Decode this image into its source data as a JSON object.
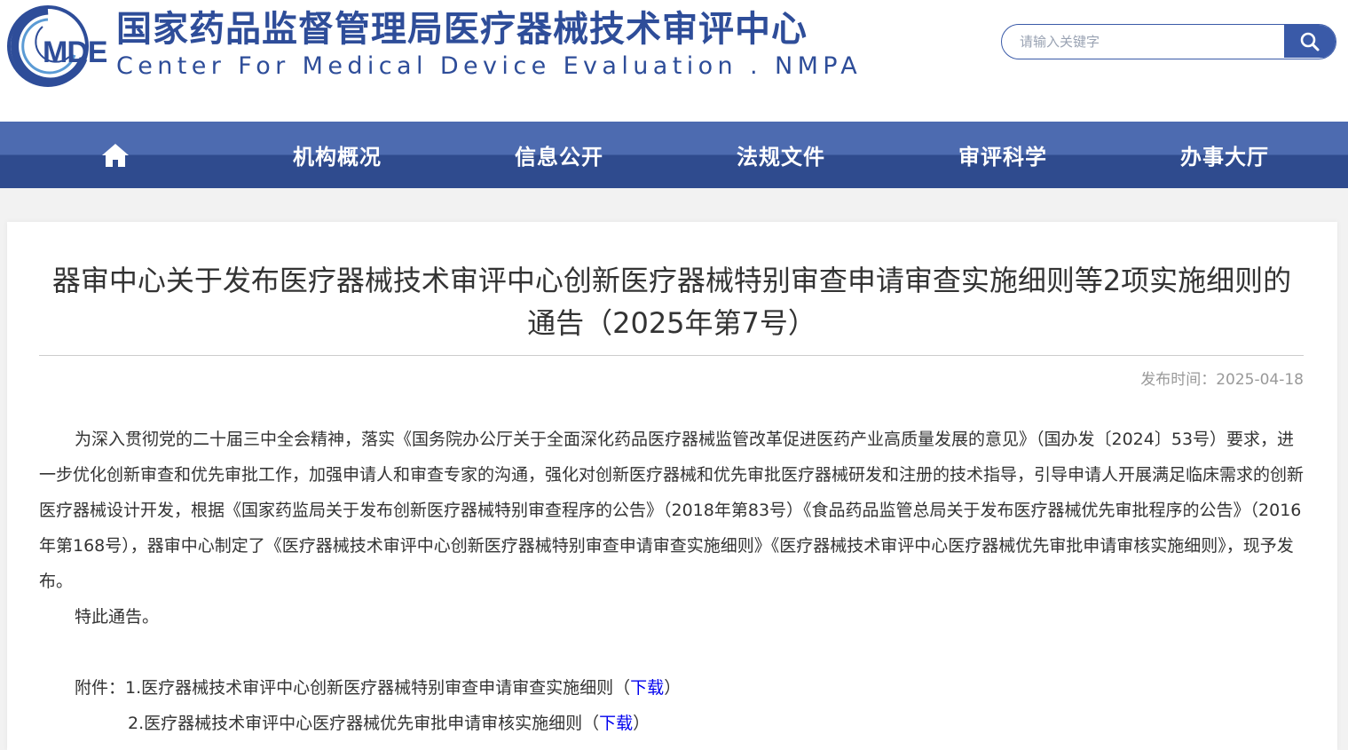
{
  "header": {
    "logo_text": "MDE",
    "title_cn": "国家药品监督管理局医疗器械技术审评中心",
    "title_en": "Center For Medical Device Evaluation . NMPA",
    "search_placeholder": "请输入关键字"
  },
  "nav": {
    "home_icon": "home-icon",
    "items": [
      "机构概况",
      "信息公开",
      "法规文件",
      "审评科学",
      "办事大厅"
    ]
  },
  "article": {
    "title": "器审中心关于发布医疗器械技术审评中心创新医疗器械特别审查申请审查实施细则等2项实施细则的通告（2025年第7号）",
    "pubtime_label": "发布时间：",
    "pubtime_value": "2025-04-18",
    "paragraph1": "为深入贯彻党的二十届三中全会精神，落实《国务院办公厅关于全面深化药品医疗器械监管改革促进医药产业高质量发展的意见》（国办发〔2024〕53号）要求，进一步优化创新审查和优先审批工作，加强申请人和审查专家的沟通，强化对创新医疗器械和优先审批医疗器械研发和注册的技术指导，引导申请人开展满足临床需求的创新医疗器械设计开发，根据《国家药监局关于发布创新医疗器械特别审查程序的公告》（2018年第83号）《食品药品监管总局关于发布医疗器械优先审批程序的公告》（2016年第168号），器审中心制定了《医疗器械技术审评中心创新医疗器械特别审查申请审查实施细则》《医疗器械技术审评中心医疗器械优先审批申请审核实施细则》，现予发布。",
    "paragraph2": "特此通告。",
    "attachments_label": "附件：",
    "attachments": [
      {
        "text": "1.医疗器械技术审评中心创新医疗器械特别审查申请审查实施细则",
        "open": "（",
        "link": "下载",
        "close": "）"
      },
      {
        "text": "2.医疗器械技术审评中心医疗器械优先审批申请审核实施细则",
        "open": "（",
        "link": "下载",
        "close": "）"
      }
    ]
  },
  "colors": {
    "brand_blue": "#2e4d99",
    "nav_top": "#4d6bb0",
    "nav_bottom": "#2f4b8e",
    "link": "#0000ee"
  }
}
